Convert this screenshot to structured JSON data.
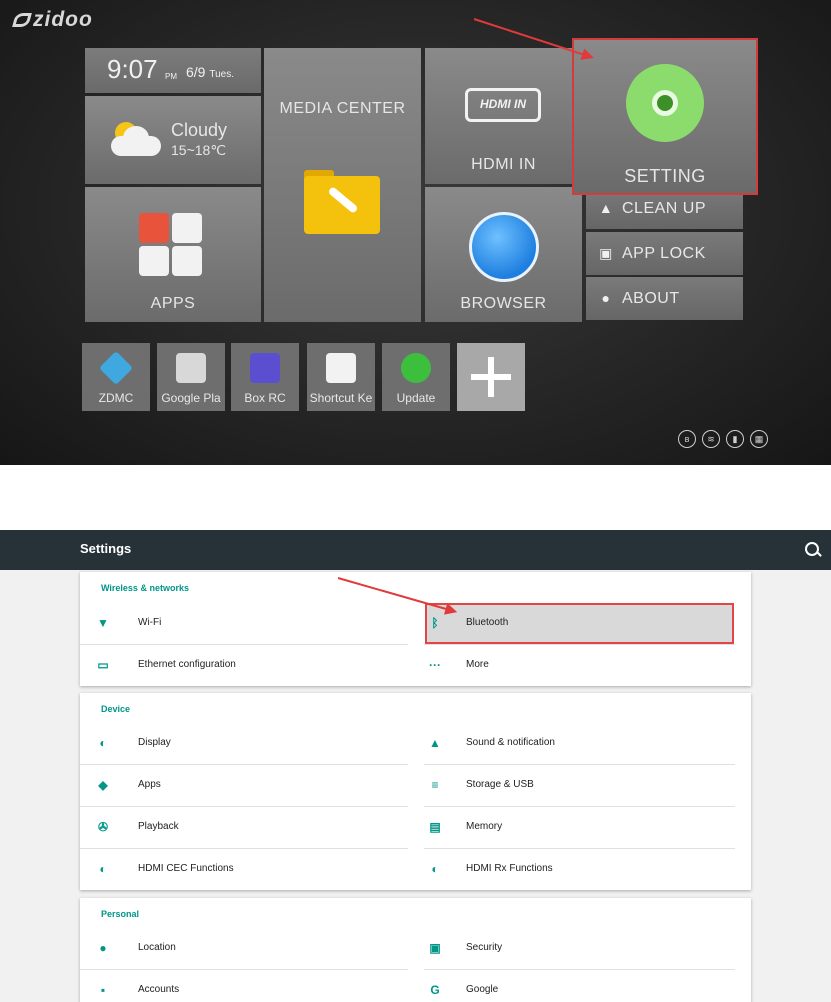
{
  "launcher": {
    "brand": "zidoo",
    "clock": {
      "time": "9:07",
      "ampm": "PM",
      "date": "6/9",
      "weekday": "Tues."
    },
    "weather": {
      "condition": "Cloudy",
      "temp": "15~18℃"
    },
    "tiles": {
      "media": "MEDIA CENTER",
      "hdmi": "HDMI IN",
      "hdmi_badge": "HDMI IN",
      "apps": "APPS",
      "browser": "BROWSER",
      "setting": "SETTING"
    },
    "side_buttons": {
      "clean": "CLEAN UP",
      "lock": "APP LOCK",
      "about": "ABOUT"
    },
    "dock": [
      {
        "label": "ZDMC",
        "color": "#3fa8e0"
      },
      {
        "label": "Google Pla",
        "color": "#d8d8d8"
      },
      {
        "label": "Box RC",
        "color": "#5b4fd0"
      },
      {
        "label": "Shortcut Ke",
        "color": "#f2f2f2"
      },
      {
        "label": "Update",
        "color": "#3cbf3c"
      }
    ],
    "status_icons": [
      "bluetooth-icon",
      "wifi-icon",
      "usb-icon",
      "network-icon"
    ]
  },
  "settings": {
    "title": "Settings",
    "wireless": {
      "header": "Wireless & networks",
      "items": [
        "Wi-Fi",
        "Bluetooth",
        "Ethernet configuration",
        "More"
      ]
    },
    "device": {
      "header": "Device",
      "items": [
        "Display",
        "Sound & notification",
        "Apps",
        "Storage & USB",
        "Playback",
        "Memory",
        "HDMI CEC Functions",
        "HDMI Rx Functions"
      ]
    },
    "personal": {
      "header": "Personal",
      "items": [
        "Location",
        "Security",
        "Accounts",
        "Google"
      ]
    },
    "accent_color": "#009688",
    "highlight_color": "#e04646"
  }
}
